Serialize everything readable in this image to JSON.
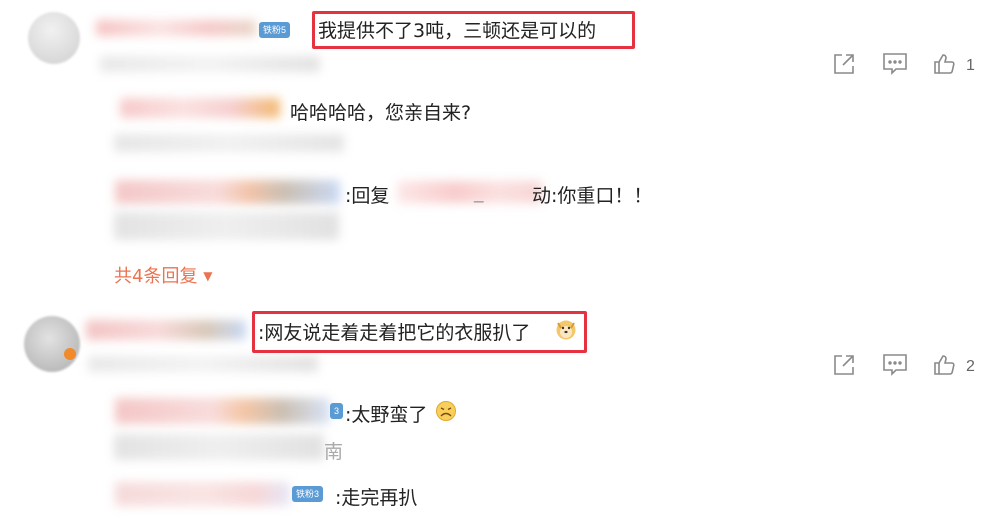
{
  "comments": [
    {
      "badge": "铁粉5",
      "text": "我提供不了3吨，三顿还是可以的",
      "like_count": "1",
      "replies": [
        {
          "text": "哈哈哈哈，您亲自来?"
        },
        {
          "text_prefix": ":回复",
          "text_middle": "_",
          "text_suffix": "动:你重口！！"
        }
      ],
      "more_replies": "共4条回复"
    },
    {
      "text": ":网友说走着走着把它的衣服扒了",
      "like_count": "2",
      "replies": [
        {
          "badge": "3",
          "text": ":太野蛮了",
          "trailing": "南"
        },
        {
          "badge": "铁粉3",
          "text": ":走完再扒"
        }
      ]
    }
  ],
  "icons": [
    "share-icon",
    "comment-icon",
    "like-icon",
    "chevron-down-icon",
    "doge-emoji-icon",
    "angry-emoji-icon"
  ],
  "colors": {
    "highlight": "#e53140",
    "link": "#eb7350",
    "badge": "#5b9bd5",
    "icon": "#8a8a8a"
  }
}
